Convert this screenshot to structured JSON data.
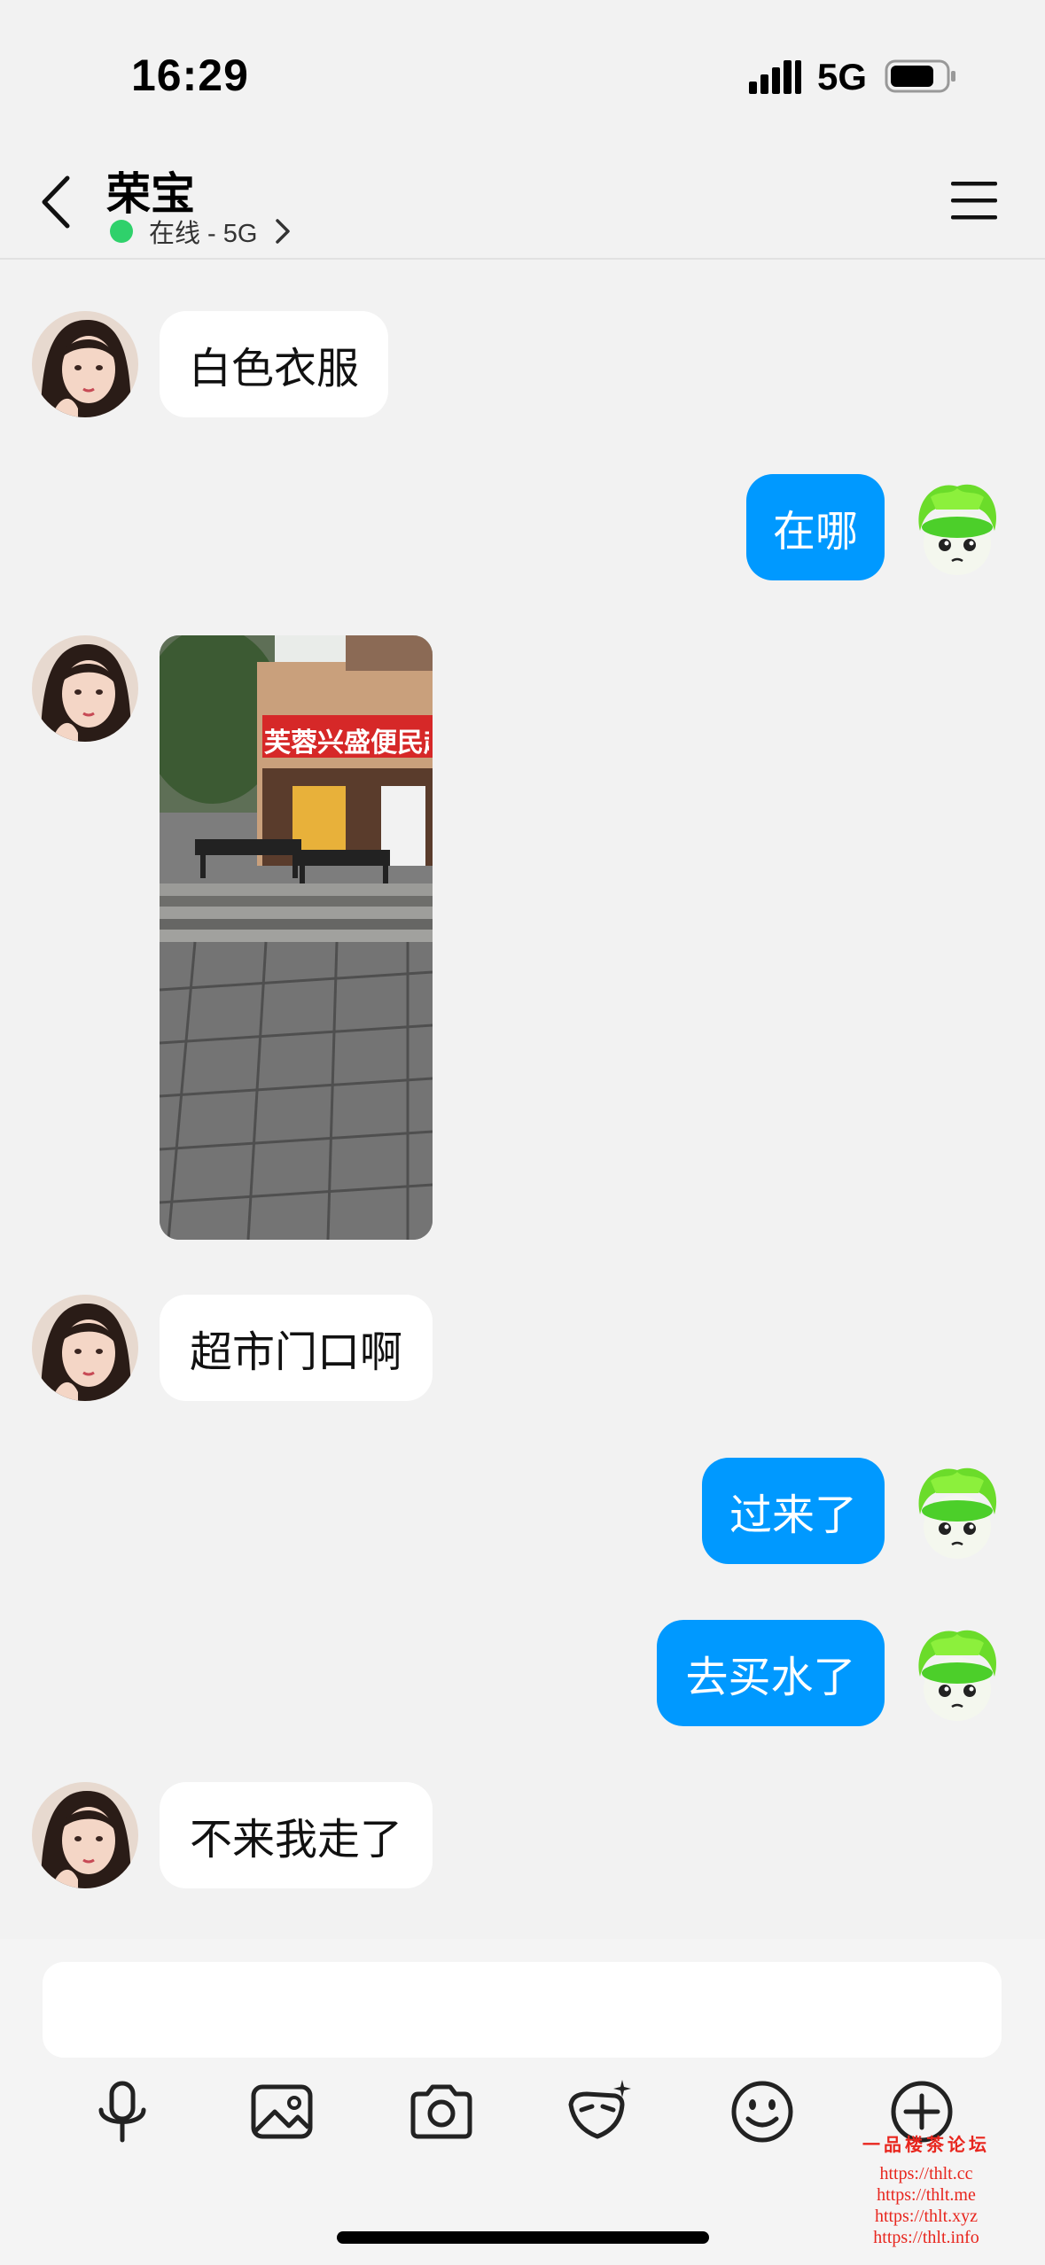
{
  "status_bar": {
    "time": "16:29",
    "network": "5G",
    "signal_icon": "signal-bars-icon",
    "battery_icon": "battery-icon"
  },
  "header": {
    "name": "荣宝",
    "status": "在线 - 5G",
    "back_icon": "chevron-left-icon",
    "menu_icon": "hamburger-menu-icon",
    "online_color": "#2fd16b"
  },
  "messages": [
    {
      "from": "contact",
      "type": "text",
      "text": "白色衣服"
    },
    {
      "from": "me",
      "type": "text",
      "text": "在哪"
    },
    {
      "from": "contact",
      "type": "image",
      "text": "芙蓉兴盛便民超市"
    },
    {
      "from": "contact",
      "type": "text",
      "text": "超市门口啊"
    },
    {
      "from": "me",
      "type": "text",
      "text": "过来了"
    },
    {
      "from": "me",
      "type": "text",
      "text": "去买水了"
    },
    {
      "from": "contact",
      "type": "text",
      "text": "不来我走了"
    }
  ],
  "toolbar": {
    "items": [
      "microphone-icon",
      "image-icon",
      "camera-icon",
      "sticker-icon",
      "emoji-icon",
      "plus-circle-icon"
    ]
  },
  "watermark": {
    "title": "一品楼茶论坛",
    "urls": [
      "https://thlt.cc",
      "https://thlt.me",
      "https://thlt.xyz",
      "https://thlt.info"
    ]
  },
  "colors": {
    "outgoing_bubble": "#0099ff",
    "incoming_bubble": "#ffffff",
    "background": "#f2f2f2"
  }
}
